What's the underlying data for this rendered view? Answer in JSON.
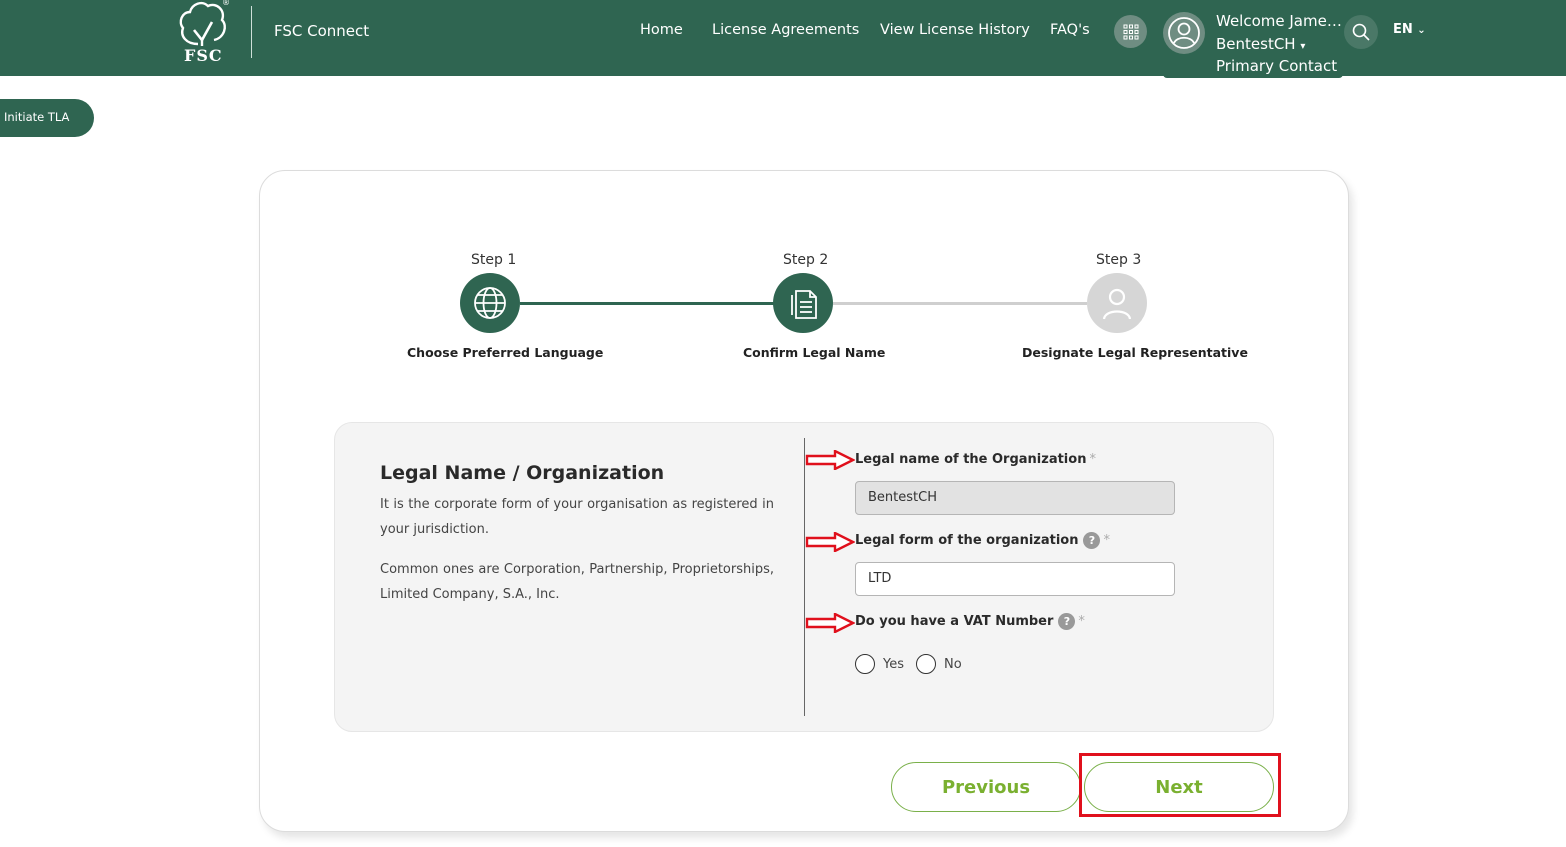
{
  "header": {
    "logo_text": "FSC",
    "logo_registered": "®",
    "brand_name": "FSC Connect",
    "nav": [
      {
        "label": "Home"
      },
      {
        "label": "License Agreements"
      },
      {
        "label": "View License History"
      },
      {
        "label": "FAQ's"
      }
    ],
    "user": {
      "welcome": "Welcome James...",
      "organization": "BentestCH",
      "role": "Primary Contact"
    },
    "language": "EN"
  },
  "sidebar_pill": "Initiate TLA",
  "stepper": {
    "steps": [
      {
        "label": "Step 1",
        "title": "Choose Preferred Language",
        "icon": "globe-icon",
        "state": "completed"
      },
      {
        "label": "Step 2",
        "title": "Confirm Legal Name",
        "icon": "document-icon",
        "state": "active"
      },
      {
        "label": "Step 3",
        "title": "Designate Legal Representative",
        "icon": "user-icon",
        "state": "pending"
      }
    ]
  },
  "form": {
    "section_title": "Legal Name / Organization",
    "description_1": "It is the corporate form of your organisation as registered in your jurisdiction.",
    "description_2": "Common ones are Corporation, Partnership,  Proprietorships, Limited Company, S.A., Inc.",
    "legal_name_label": "Legal name of the Organization",
    "legal_name_value": "BentestCH",
    "legal_form_label": "Legal form of the organization",
    "legal_form_value": "LTD",
    "vat_label": "Do you have a VAT Number",
    "required_mark": "*",
    "help_mark": "?",
    "vat_options": [
      "Yes",
      "No"
    ]
  },
  "buttons": {
    "previous": "Previous",
    "next": "Next"
  },
  "colors": {
    "brand_green": "#2f6551",
    "accent_green": "#7ab030",
    "annotation_red": "#e0101c",
    "inactive_step": "#d6d6d6"
  }
}
